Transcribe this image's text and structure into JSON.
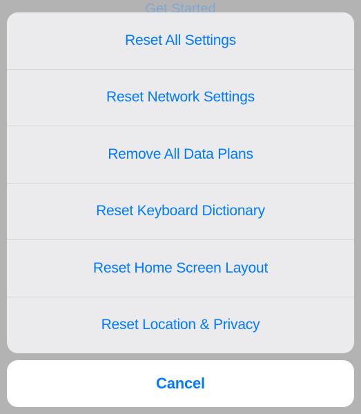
{
  "background": {
    "partial_text": "Get Started"
  },
  "actionSheet": {
    "options": [
      {
        "label": "Reset All Settings"
      },
      {
        "label": "Reset Network Settings"
      },
      {
        "label": "Remove All Data Plans"
      },
      {
        "label": "Reset Keyboard Dictionary"
      },
      {
        "label": "Reset Home Screen Layout"
      },
      {
        "label": "Reset Location & Privacy"
      }
    ],
    "cancel_label": "Cancel"
  },
  "colors": {
    "accent": "#007aff",
    "sheet_bg": "#ebebed",
    "cancel_bg": "#ffffff",
    "backdrop": "#b3b3b3"
  }
}
